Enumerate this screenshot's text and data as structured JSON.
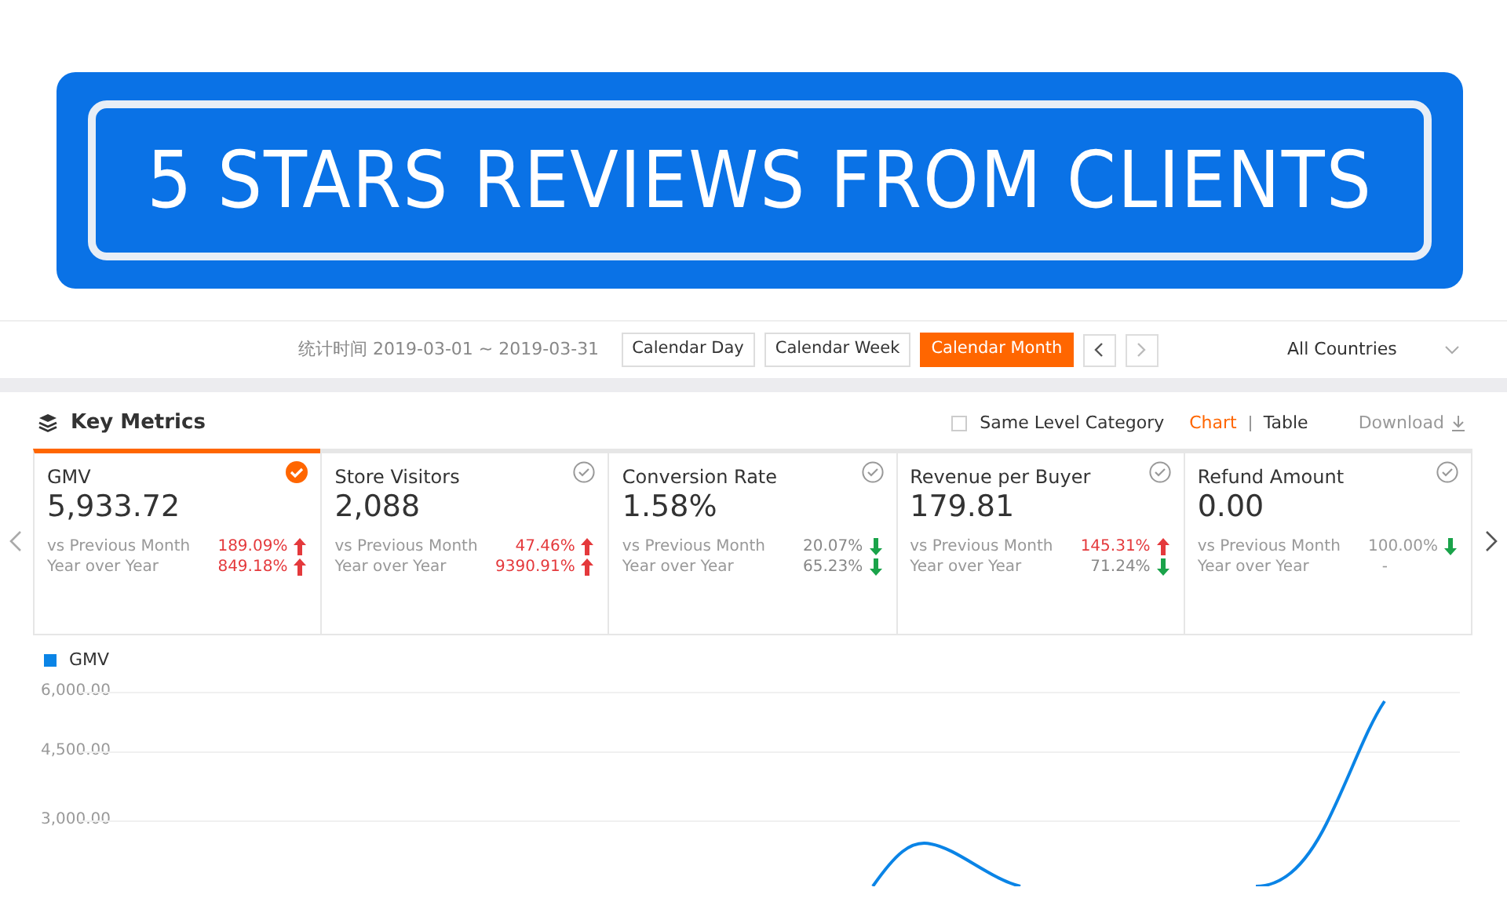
{
  "banner": {
    "title": "5 STARS REVIEWS FROM CLIENTS"
  },
  "toolbar": {
    "date_range": "统计时间 2019-03-01 ~ 2019-03-31",
    "periods": [
      {
        "label": "Calendar Day",
        "selected": false
      },
      {
        "label": "Calendar Week",
        "selected": false
      },
      {
        "label": "Calendar Month",
        "selected": true
      }
    ],
    "country": "All Countries"
  },
  "section": {
    "title": "Key Metrics",
    "same_level": {
      "label": "Same Level Category",
      "checked": false
    },
    "views": [
      {
        "label": "Chart",
        "selected": true
      },
      {
        "label": "Table",
        "selected": false
      }
    ],
    "download": "Download"
  },
  "metrics": [
    {
      "name": "GMV",
      "value": "5,933.72",
      "selected": true,
      "muted": false,
      "compare": [
        {
          "label": "vs Previous Month",
          "change": "189.09%",
          "arrow": true,
          "rising": true
        },
        {
          "label": "Year over Year",
          "change": "849.18%",
          "arrow": true,
          "rising": true
        }
      ]
    },
    {
      "name": "Store Visitors",
      "value": "2,088",
      "selected": false,
      "muted": false,
      "compare": [
        {
          "label": "vs Previous Month",
          "change": "47.46%",
          "arrow": true,
          "rising": true
        },
        {
          "label": "Year over Year",
          "change": "9390.91%",
          "arrow": true,
          "rising": true
        }
      ]
    },
    {
      "name": "Conversion Rate",
      "value": "1.58%",
      "selected": false,
      "muted": false,
      "compare": [
        {
          "label": "vs Previous Month",
          "change": "20.07%",
          "arrow": true,
          "rising": false
        },
        {
          "label": "Year over Year",
          "change": "65.23%",
          "arrow": true,
          "rising": false
        }
      ]
    },
    {
      "name": "Revenue per Buyer",
      "value": "179.81",
      "selected": false,
      "muted": false,
      "compare": [
        {
          "label": "vs Previous Month",
          "change": "145.31%",
          "arrow": true,
          "rising": true
        },
        {
          "label": "Year over Year",
          "change": "71.24%",
          "arrow": true,
          "rising": false
        }
      ]
    },
    {
      "name": "Refund Amount",
      "value": "0.00",
      "selected": false,
      "muted": true,
      "compare": [
        {
          "label": "vs Previous Month",
          "change": "100.00%",
          "arrow": true,
          "rising": false
        },
        {
          "label": "Year over Year",
          "change": "-",
          "arrow": false
        }
      ]
    }
  ],
  "chart": {
    "legend": "GMV",
    "axis_labels": [
      "6,000.00",
      "4,500.00",
      "3,000.00"
    ]
  }
}
